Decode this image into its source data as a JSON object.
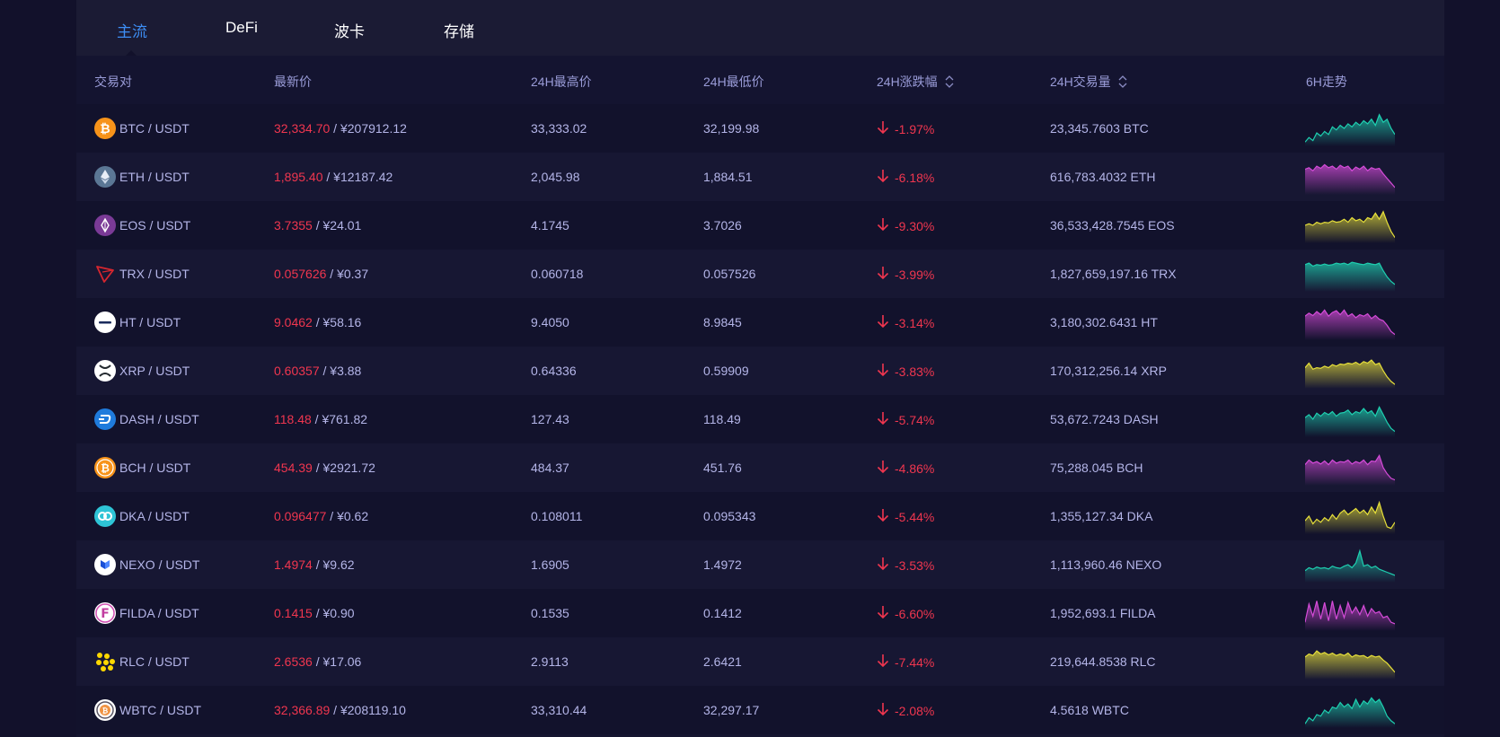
{
  "tabs": [
    {
      "label": "主流",
      "active": true
    },
    {
      "label": "DeFi",
      "active": false
    },
    {
      "label": "波卡",
      "active": false
    },
    {
      "label": "存储",
      "active": false
    }
  ],
  "headers": {
    "pair": "交易对",
    "last": "最新价",
    "high": "24H最高价",
    "low": "24H最低价",
    "change": "24H涨跌幅",
    "volume": "24H交易量",
    "trend": "6H走势"
  },
  "colors": {
    "down": "#f0364f",
    "teal": "#1ecfb0",
    "magenta": "#d44bd8",
    "yellow": "#e6df3a"
  },
  "rows": [
    {
      "icon": "bitcoin-icon",
      "pair": "BTC / USDT",
      "last": "32,334.70",
      "cny": " / ¥207912.12",
      "high": "33,333.02",
      "low": "32,199.98",
      "change": "-1.97%",
      "volume": "23,345.7603 BTC",
      "trend_color": "#1ecfb0",
      "trend": [
        0.05,
        0.2,
        0.1,
        0.35,
        0.25,
        0.4,
        0.3,
        0.55,
        0.45,
        0.6,
        0.5,
        0.65,
        0.55,
        0.7,
        0.6,
        0.75,
        0.65,
        0.8,
        0.6,
        0.95,
        0.7,
        0.8,
        0.5,
        0.3
      ]
    },
    {
      "icon": "ethereum-icon",
      "pair": "ETH / USDT",
      "last": "1,895.40",
      "cny": " / ¥12187.42",
      "high": "2,045.98",
      "low": "1,884.51",
      "change": "-6.18%",
      "volume": "616,783.4032 ETH",
      "trend_color": "#d44bd8",
      "trend": [
        0.75,
        0.8,
        0.7,
        0.85,
        0.78,
        0.9,
        0.8,
        0.85,
        0.75,
        0.88,
        0.8,
        0.85,
        0.7,
        0.82,
        0.75,
        0.85,
        0.7,
        0.8,
        0.75,
        0.78,
        0.6,
        0.45,
        0.3,
        0.15
      ]
    },
    {
      "icon": "eos-icon",
      "pair": "EOS / USDT",
      "last": "3.7355",
      "cny": " / ¥24.01",
      "high": "4.1745",
      "low": "3.7026",
      "change": "-9.30%",
      "volume": "36,533,428.7545 EOS",
      "trend_color": "#e6df3a",
      "trend": [
        0.5,
        0.55,
        0.5,
        0.6,
        0.55,
        0.6,
        0.58,
        0.65,
        0.6,
        0.62,
        0.7,
        0.6,
        0.75,
        0.65,
        0.7,
        0.6,
        0.75,
        0.7,
        0.9,
        0.7,
        0.95,
        0.6,
        0.3,
        0.1
      ]
    },
    {
      "icon": "tron-icon",
      "pair": "TRX / USDT",
      "last": "0.057626",
      "cny": " / ¥0.37",
      "high": "0.060718",
      "low": "0.057526",
      "change": "-3.99%",
      "volume": "1,827,659,197.16 TRX",
      "trend_color": "#1ecfb0",
      "trend": [
        0.8,
        0.85,
        0.75,
        0.8,
        0.78,
        0.82,
        0.78,
        0.8,
        0.85,
        0.82,
        0.85,
        0.8,
        0.88,
        0.85,
        0.82,
        0.8,
        0.85,
        0.82,
        0.8,
        0.85,
        0.6,
        0.4,
        0.25,
        0.15
      ]
    },
    {
      "icon": "huobi-token-icon",
      "pair": "HT / USDT",
      "last": "9.0462",
      "cny": " / ¥58.16",
      "high": "9.4050",
      "low": "8.9845",
      "change": "-3.14%",
      "volume": "3,180,302.6431 HT",
      "trend_color": "#d44bd8",
      "trend": [
        0.7,
        0.8,
        0.72,
        0.85,
        0.75,
        0.9,
        0.7,
        0.82,
        0.88,
        0.75,
        0.9,
        0.7,
        0.78,
        0.65,
        0.75,
        0.7,
        0.78,
        0.62,
        0.72,
        0.6,
        0.55,
        0.4,
        0.2,
        0.1
      ]
    },
    {
      "icon": "ripple-icon",
      "pair": "XRP / USDT",
      "last": "0.60357",
      "cny": " / ¥3.88",
      "high": "0.64336",
      "low": "0.59909",
      "change": "-3.83%",
      "volume": "170,312,256.14 XRP",
      "trend_color": "#e6df3a",
      "trend": [
        0.6,
        0.75,
        0.55,
        0.6,
        0.58,
        0.65,
        0.6,
        0.7,
        0.65,
        0.72,
        0.7,
        0.75,
        0.72,
        0.78,
        0.7,
        0.8,
        0.75,
        0.85,
        0.7,
        0.75,
        0.5,
        0.3,
        0.15,
        0.05
      ]
    },
    {
      "icon": "dash-icon",
      "pair": "DASH / USDT",
      "last": "118.48",
      "cny": " / ¥761.82",
      "high": "127.43",
      "low": "118.49",
      "change": "-5.74%",
      "volume": "53,672.7243 DASH",
      "trend_color": "#1ecfb0",
      "trend": [
        0.55,
        0.65,
        0.5,
        0.7,
        0.6,
        0.72,
        0.65,
        0.75,
        0.6,
        0.7,
        0.72,
        0.8,
        0.65,
        0.75,
        0.7,
        0.85,
        0.7,
        0.78,
        0.6,
        0.9,
        0.65,
        0.4,
        0.2,
        0.1
      ]
    },
    {
      "icon": "bitcoin-cash-icon",
      "pair": "BCH / USDT",
      "last": "454.39",
      "cny": " / ¥2921.72",
      "high": "484.37",
      "low": "451.76",
      "change": "-4.86%",
      "volume": "75,288.045 BCH",
      "trend_color": "#d44bd8",
      "trend": [
        0.6,
        0.75,
        0.65,
        0.7,
        0.62,
        0.72,
        0.6,
        0.75,
        0.65,
        0.7,
        0.68,
        0.75,
        0.62,
        0.7,
        0.65,
        0.75,
        0.6,
        0.72,
        0.7,
        0.9,
        0.5,
        0.3,
        0.15,
        0.1
      ]
    },
    {
      "icon": "dka-icon",
      "pair": "DKA / USDT",
      "last": "0.096477",
      "cny": " / ¥0.62",
      "high": "0.108011",
      "low": "0.095343",
      "change": "-5.44%",
      "volume": "1,355,127.34 DKA",
      "trend_color": "#e6df3a",
      "trend": [
        0.35,
        0.5,
        0.25,
        0.4,
        0.3,
        0.45,
        0.35,
        0.55,
        0.4,
        0.6,
        0.7,
        0.55,
        0.65,
        0.75,
        0.6,
        0.7,
        0.55,
        0.8,
        0.6,
        0.95,
        0.5,
        0.15,
        0.1,
        0.3
      ]
    },
    {
      "icon": "nexo-icon",
      "pair": "NEXO / USDT",
      "last": "1.4974",
      "cny": " / ¥9.62",
      "high": "1.6905",
      "low": "1.4972",
      "change": "-3.53%",
      "volume": "1,113,960.46 NEXO",
      "trend_color": "#1ecfb0",
      "trend": [
        0.3,
        0.4,
        0.35,
        0.42,
        0.38,
        0.4,
        0.36,
        0.45,
        0.4,
        0.38,
        0.45,
        0.5,
        0.4,
        0.55,
        0.95,
        0.45,
        0.5,
        0.4,
        0.45,
        0.35,
        0.3,
        0.25,
        0.2,
        0.15
      ]
    },
    {
      "icon": "filda-icon",
      "pair": "FILDA / USDT",
      "last": "0.1415",
      "cny": " / ¥0.90",
      "high": "0.1535",
      "low": "0.1412",
      "change": "-6.60%",
      "volume": "1,952,693.1 FILDA",
      "trend_color": "#d44bd8",
      "trend": [
        0.2,
        0.8,
        0.4,
        0.9,
        0.3,
        0.85,
        0.25,
        0.9,
        0.3,
        0.75,
        0.35,
        0.85,
        0.5,
        0.7,
        0.45,
        0.75,
        0.4,
        0.65,
        0.5,
        0.55,
        0.35,
        0.4,
        0.2,
        0.15
      ]
    },
    {
      "icon": "rlc-icon",
      "pair": "RLC / USDT",
      "last": "2.6536",
      "cny": " / ¥17.06",
      "high": "2.9113",
      "low": "2.6421",
      "change": "-7.44%",
      "volume": "219,644.8538 RLC",
      "trend_color": "#e6df3a",
      "trend": [
        0.65,
        0.75,
        0.7,
        0.85,
        0.75,
        0.8,
        0.72,
        0.78,
        0.7,
        0.75,
        0.7,
        0.78,
        0.65,
        0.72,
        0.68,
        0.7,
        0.62,
        0.7,
        0.65,
        0.68,
        0.55,
        0.45,
        0.3,
        0.15
      ]
    },
    {
      "icon": "wrapped-bitcoin-icon",
      "pair": "WBTC / USDT",
      "last": "32,366.89",
      "cny": " / ¥208119.10",
      "high": "33,310.44",
      "low": "32,297.17",
      "change": "-2.08%",
      "volume": "4.5618 WBTC",
      "trend_color": "#1ecfb0",
      "trend": [
        0.05,
        0.25,
        0.15,
        0.35,
        0.3,
        0.5,
        0.4,
        0.6,
        0.55,
        0.75,
        0.6,
        0.7,
        0.55,
        0.85,
        0.6,
        0.8,
        0.7,
        0.9,
        0.75,
        0.85,
        0.6,
        0.3,
        0.15,
        0.05
      ]
    }
  ]
}
